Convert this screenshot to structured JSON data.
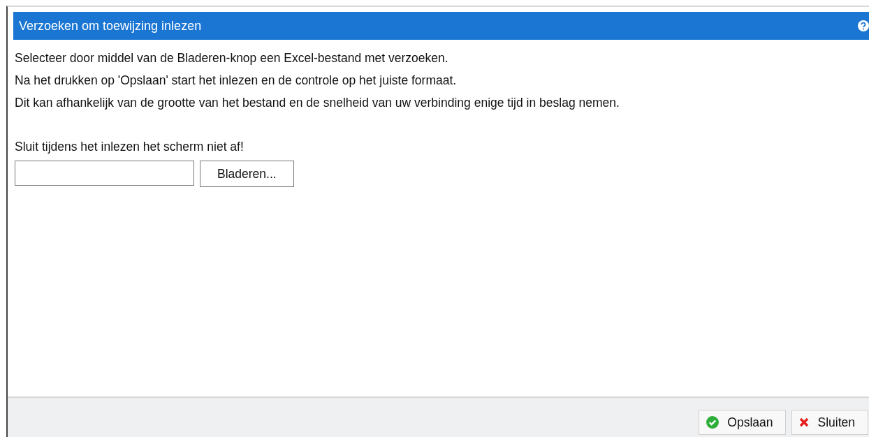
{
  "dialog": {
    "title": "Verzoeken om toewijzing inlezen",
    "instructions": [
      "Selecteer door middel van de Bladeren-knop een Excel-bestand met verzoeken.",
      "Na het drukken op 'Opslaan' start het inlezen en de controle op het juiste formaat.",
      "Dit kan afhankelijk van de grootte van het bestand en de snelheid van uw verbinding enige tijd in beslag nemen."
    ],
    "warning": "Sluit tijdens het inlezen het scherm niet af!",
    "file_field": {
      "browse_button": "Bladeren..."
    },
    "buttons": [
      {
        "kind": "save",
        "label": "Opslaan"
      },
      {
        "kind": "close",
        "label": "Sluiten"
      }
    ]
  }
}
